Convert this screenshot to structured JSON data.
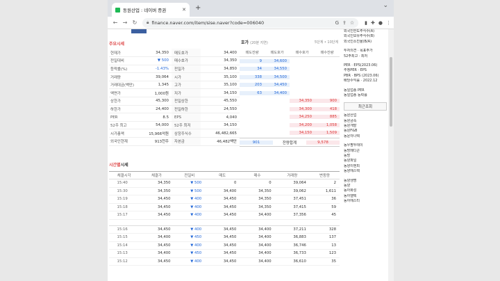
{
  "browser": {
    "tab_title": "동원산업 : 네이버 증권",
    "url": "finance.naver.com/item/sise.naver?code=006040"
  },
  "main_quote": {
    "title": "주요시세",
    "rows": [
      {
        "l": "현재가",
        "v": "34,350",
        "vc": "",
        "l2": "매도호가",
        "v2": "34,400"
      },
      {
        "l": "전일대비",
        "v": "▼ 500",
        "vc": "blue",
        "l2": "매수호가",
        "v2": "34,350"
      },
      {
        "l": "등락률(%)",
        "v": "-1.43%",
        "vc": "blue",
        "l2": "전일가",
        "v2": "34,850"
      },
      {
        "l": "거래량",
        "v": "39,064",
        "vc": "",
        "l2": "시가",
        "v2": "35,100"
      },
      {
        "l": "거래대금(백만)",
        "v": "1,345",
        "vc": "",
        "l2": "고가",
        "v2": "35,100"
      },
      {
        "l": "액면가",
        "v": "1,000원",
        "vc": "",
        "l2": "저가",
        "v2": "34,150"
      },
      {
        "l": "상한가",
        "v": "45,300",
        "vc": "",
        "l2": "전일상한",
        "v2": "45,550"
      },
      {
        "l": "하한가",
        "v": "24,400",
        "vc": "",
        "l2": "전일하한",
        "v2": "24,550"
      },
      {
        "l": "PER",
        "v": "8.5",
        "vc": "",
        "l2": "EPS",
        "v2": "4,040"
      },
      {
        "l": "52주 최고",
        "v": "54,000",
        "vc": "",
        "l2": "52주 최저",
        "v2": "34,150"
      },
      {
        "l": "시가총액",
        "v": "15,966억원",
        "vc": "",
        "l2": "상장주식수",
        "v2": "46,482,665"
      },
      {
        "l": "외국인현재",
        "v": "913천주",
        "vc": "",
        "l2": "자본금",
        "v2": "46,482백만"
      }
    ]
  },
  "orderbook": {
    "title": "호가",
    "time": "(20분 지연)",
    "link": "5단계 • 10단계",
    "headers": [
      "매도잔량",
      "매도호가",
      "매수호가",
      "매수잔량"
    ],
    "sell": [
      [
        "9",
        "34,600"
      ],
      [
        "34",
        "34,550"
      ],
      [
        "338",
        "34,500"
      ],
      [
        "203",
        "34,450"
      ],
      [
        "63",
        "34,400"
      ]
    ],
    "buy": [
      [
        "34,350",
        "900"
      ],
      [
        "34,300",
        "418"
      ],
      [
        "34,250",
        "885"
      ],
      [
        "34,200",
        "1,058"
      ],
      [
        "34,150",
        "1,509"
      ]
    ],
    "total": {
      "sell": "901",
      "label": "잔량합계",
      "buy": "9,578"
    }
  },
  "time_quote": {
    "title": "시간별",
    "title2": "시세",
    "headers": [
      "체결시각",
      "체결가",
      "전일비",
      "매도",
      "매수",
      "거래량",
      "변동량"
    ],
    "rows": [
      [
        "15:40",
        "34,350",
        "▼ 500",
        "0",
        "0",
        "39,064",
        "2"
      ],
      [
        "15:30",
        "34,350",
        "▼ 500",
        "34,400",
        "34,350",
        "39,062",
        "1,611"
      ],
      [
        "15:19",
        "34,450",
        "▼ 400",
        "34,450",
        "34,350",
        "37,451",
        "36"
      ],
      [
        "15:18",
        "34,450",
        "▼ 400",
        "34,450",
        "34,350",
        "37,415",
        "59"
      ],
      [
        "15:17",
        "34,450",
        "▼ 400",
        "34,450",
        "34,400",
        "37,356",
        "45"
      ],
      [
        "GAP"
      ],
      [
        "15:16",
        "34,450",
        "▼ 400",
        "34,450",
        "34,400",
        "37,211",
        "328"
      ],
      [
        "15:15",
        "34,400",
        "▼ 450",
        "34,450",
        "34,400",
        "36,883",
        "137"
      ],
      [
        "15:14",
        "34,450",
        "▼ 400",
        "34,450",
        "34,400",
        "36,746",
        "13"
      ],
      [
        "15:13",
        "34,400",
        "▼ 450",
        "34,450",
        "34,400",
        "36,733",
        "123"
      ],
      [
        "15:12",
        "34,450",
        "▼ 400",
        "34,450",
        "34,400",
        "36,610",
        "35"
      ]
    ]
  },
  "sidebar": {
    "top": [
      "외국인한도주식수(A)",
      "외국인보유주식수(B)",
      "외국인소진율(B/A)"
    ],
    "mid": [
      "투자의견 · 목표주가",
      "52주최고 · 최저"
    ],
    "per": [
      "PER · EPS(2023.06)",
      "추정PER · EPS",
      "PBR · BPS (2023.06)",
      "배당수익률 · 2022.12"
    ],
    "same": [
      "동일업종 PER",
      "동일업종 등락률"
    ],
    "recent_label": "최근조회",
    "list1": [
      "동원산업",
      "동원금속",
      "동원개발",
      "동원F&B",
      "동운아나텍"
    ],
    "list2": [
      "동우팜투테이",
      "동방메디콘",
      "동방",
      "동양파일",
      "동양이엔피",
      "동양에스텍"
    ],
    "list3": [
      "동양생명",
      "동양",
      "동아화성",
      "동아엘텍",
      "동아에스티"
    ]
  }
}
